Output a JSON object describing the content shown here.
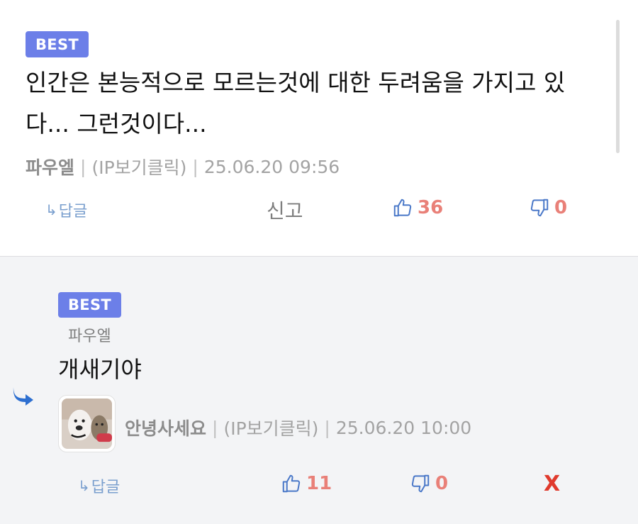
{
  "comment": {
    "badge": "BEST",
    "text": "인간은 본능적으로 모르는것에 대한 두려움을 가지고 있다... 그런것이다...",
    "author": "파우엘",
    "separator": "|",
    "ip": "(IP보기클릭)",
    "timestamp": "25.06.20 09:56",
    "reply_label": "답글",
    "reply_arrow": "↳",
    "report_label": "신고",
    "likes": "36",
    "dislikes": "0"
  },
  "reply": {
    "badge": "BEST",
    "parent_author": "파우엘",
    "text": "개새기야",
    "author": "안녕사세요",
    "separator": "|",
    "ip": "(IP보기클릭)",
    "timestamp": "25.06.20 10:00",
    "reply_label": "답글",
    "reply_arrow": "↳",
    "likes": "11",
    "dislikes": "0",
    "delete_label": "X"
  },
  "icons": {
    "reply_indicator": "curved-arrow-right-icon",
    "like": "thumbs-up-icon",
    "dislike": "thumbs-down-icon"
  },
  "colors": {
    "badge": "#6c7fe8",
    "accent_blue": "#4a78c8",
    "count_red": "#e98078",
    "delete_red": "#e03a2d",
    "reply_bg": "#f3f4f6"
  }
}
